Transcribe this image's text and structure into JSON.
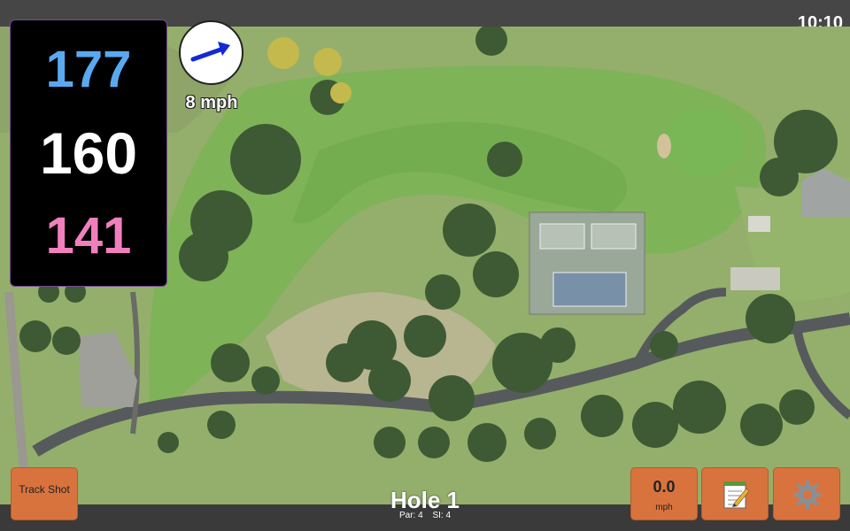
{
  "status_bar": {
    "time": "10:10"
  },
  "distances": {
    "back": "177",
    "middle": "160",
    "front": "141",
    "colors": {
      "back": "#5aa9f0",
      "middle": "#ffffff",
      "front": "#f07fbd"
    }
  },
  "wind": {
    "speed": "8 mph",
    "arrow_color": "#1428d8"
  },
  "buttons": {
    "track_shot": "Track Shot",
    "speed_value": "0.0",
    "speed_unit": "mph",
    "notes_icon": "notepad-icon",
    "settings_icon": "gear-icon"
  },
  "hole": {
    "title": "Hole 1",
    "par": "Par: 4",
    "stroke_index": "SI: 4"
  },
  "colors": {
    "button": "#d9733e",
    "bar": "#464646"
  }
}
